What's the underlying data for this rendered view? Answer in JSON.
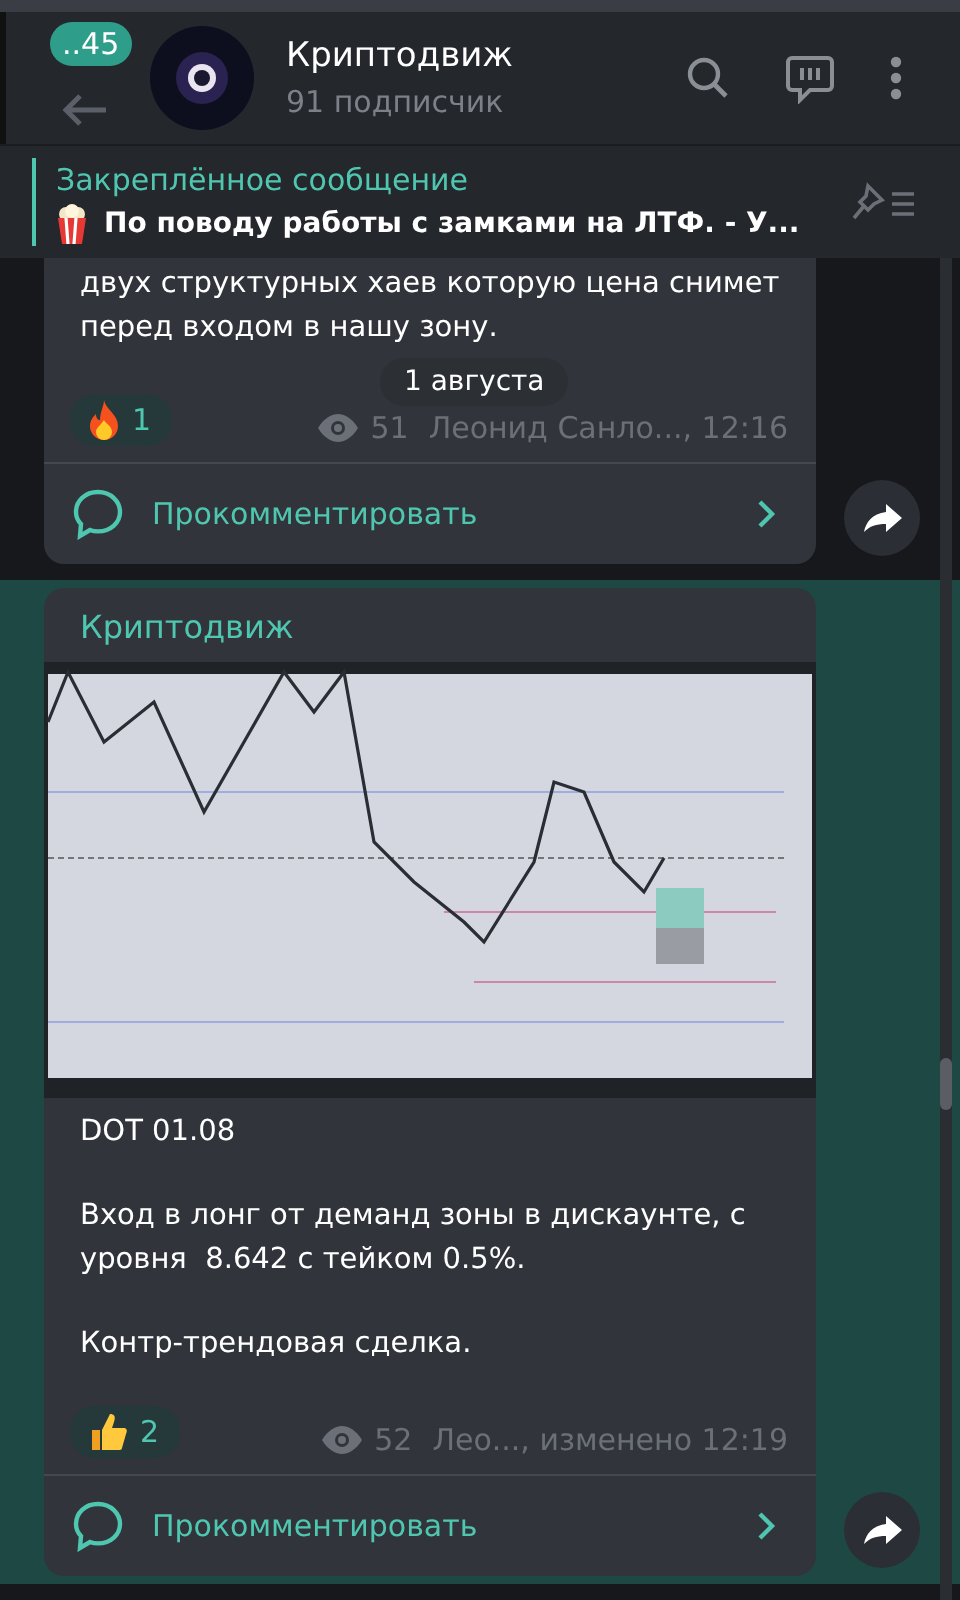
{
  "header": {
    "unread_badge": "..45",
    "title": "Криптодвиж",
    "subtitle": "91 подписчик"
  },
  "pinned": {
    "label": "Закреплённое сообщение",
    "text": "По поводу работы с замками на ЛТФ.  - У..."
  },
  "date_pill": "1 августа",
  "messages": [
    {
      "highlighted": false,
      "paragraphs": [
        "двух структурных хаев которую цена снимет перед входом в нашу зону."
      ],
      "reaction": {
        "kind": "fire",
        "count": "1"
      },
      "views": "51",
      "signature": "Леонид Санло..., 12:16",
      "comment_label": "Прокомментировать"
    },
    {
      "highlighted": true,
      "author": "Криптодвиж",
      "paragraphs": [
        "DOT 01.08",
        "Вход в лонг от деманд зоны в дискаунте, с уровня  8.642 с тейком 0.5%.",
        "Контр-трендовая сделка."
      ],
      "reaction": {
        "kind": "thumbs_up",
        "count": "2"
      },
      "views": "52",
      "signature": "Лео..., изменено 12:19",
      "comment_label": "Прокомментировать"
    }
  ]
}
